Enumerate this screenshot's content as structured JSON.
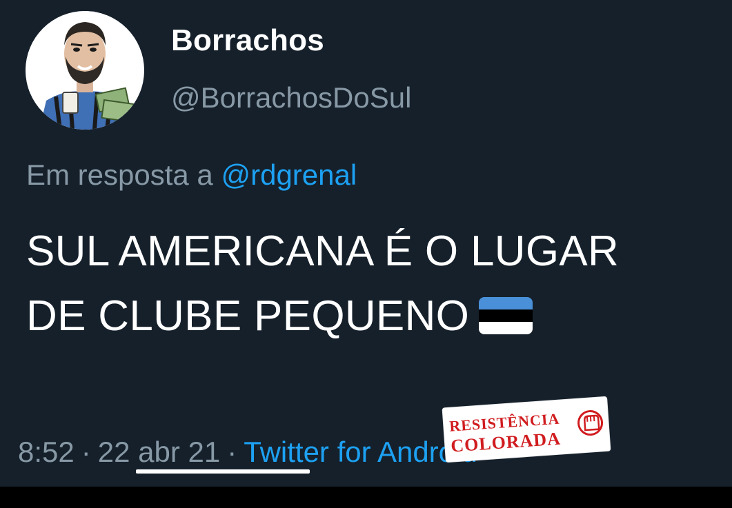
{
  "tweet": {
    "display_name": "Borrachos",
    "handle": "@BorrachosDoSul",
    "reply_prefix": "Em resposta a",
    "reply_mention": "@rdgrenal",
    "body_line_1": "SUL AMERICANA É O LUGAR",
    "body_line_2": "DE CLUBE PEQUENO",
    "emoji_icon": "flag-blue-black-white-icon",
    "time": "8:52",
    "separator": "·",
    "date": "22 abr 21",
    "source": "Twitter for Android"
  },
  "watermark": {
    "line_1": "RESISTÊNCIA",
    "line_2": "COLORADA",
    "icon": "raised-fist-icon"
  },
  "colors": {
    "background": "#15202b",
    "text_primary": "#ffffff",
    "text_secondary": "#8899a6",
    "accent": "#1da1f2",
    "watermark_red": "#d01c1f"
  }
}
